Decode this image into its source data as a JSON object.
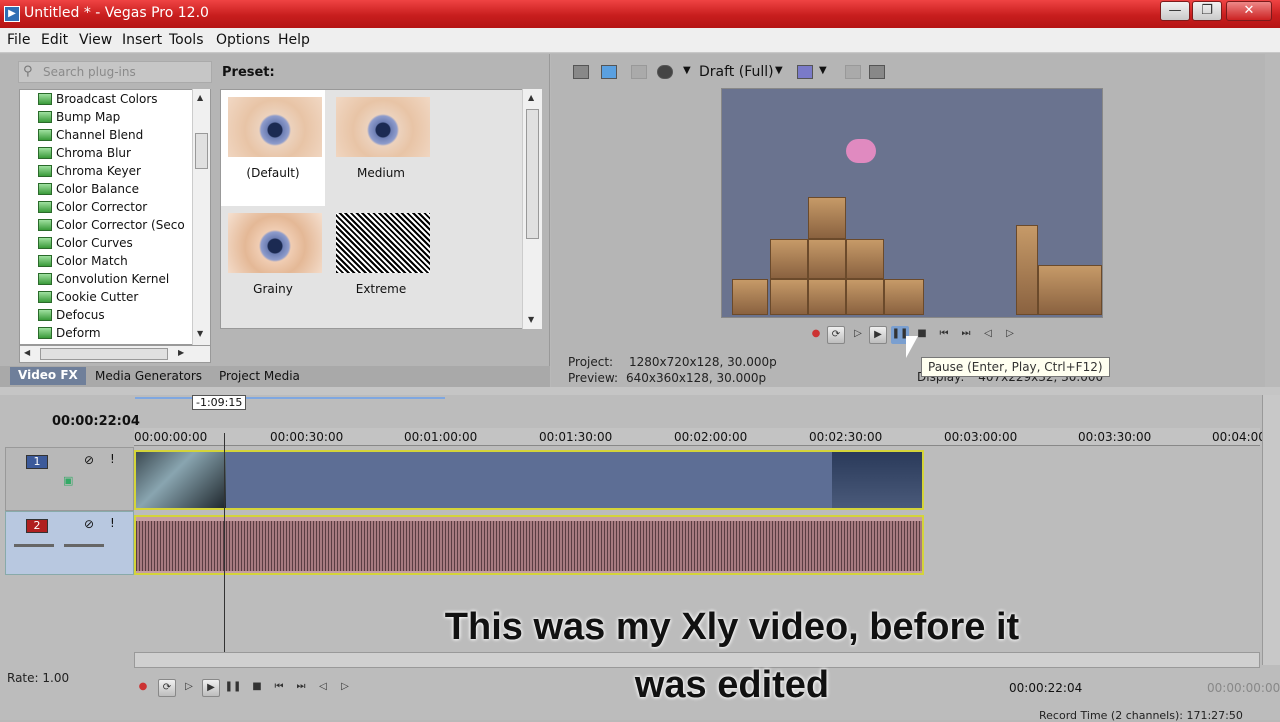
{
  "window": {
    "title": "Untitled * - Vegas Pro 12.0",
    "min": "—",
    "max": "❐",
    "close": "✕"
  },
  "menu": [
    "File",
    "Edit",
    "View",
    "Insert",
    "Tools",
    "Options",
    "Help"
  ],
  "fx_pane": {
    "search_placeholder": "Search plug-ins",
    "plugins": [
      "Broadcast Colors",
      "Bump Map",
      "Channel Blend",
      "Chroma Blur",
      "Chroma Keyer",
      "Color Balance",
      "Color Corrector",
      "Color Corrector (Seco",
      "Color Curves",
      "Color Match",
      "Convolution Kernel",
      "Cookie Cutter",
      "Defocus",
      "Deform"
    ],
    "preset_label": "Preset:",
    "presets": [
      "(Default)",
      "Medium",
      "Grainy",
      "Extreme"
    ],
    "tabs": [
      "Video FX",
      "Media Generators",
      "Project Media"
    ]
  },
  "preview": {
    "quality": "Draft (Full)",
    "project_label": "Project:",
    "project_value": "1280x720x128, 30.000p",
    "preview_label": "Preview:",
    "preview_value": "640x360x128, 30.000p",
    "display_label": "Display:",
    "display_value": "407x229x32, 30.000",
    "tooltip": "Pause (Enter, Play, Ctrl+F12)"
  },
  "timeline": {
    "cursor_time": "00:00:22:04",
    "marker": "-1:09:15",
    "ruler": [
      "00:00:00:00",
      "00:00:30:00",
      "00:01:00:00",
      "00:01:30:00",
      "00:02:00:00",
      "00:02:30:00",
      "00:03:00:00",
      "00:03:30:00",
      "00:04:00:"
    ],
    "track1": "1",
    "track2": "2",
    "rate": "Rate: 1.00",
    "time_right": "00:00:22:04",
    "time_right2": "00:00:00:00",
    "record": "Record Time (2 channels): 171:27:50"
  },
  "caption": "This was my Xly video, before it was edited"
}
